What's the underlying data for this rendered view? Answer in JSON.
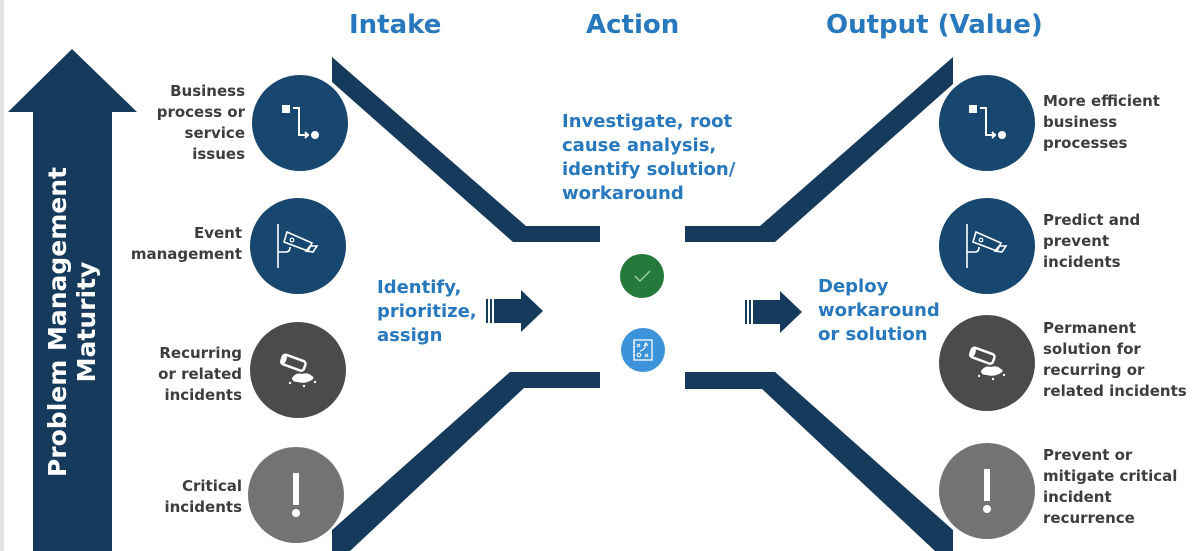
{
  "colors": {
    "navy": "#17466f",
    "dark_navy": "#153a5c",
    "accent_blue": "#2878bd",
    "text_gray": "#3d3d3d",
    "dark_gray": "#4a4b4b",
    "mid_gray": "#737373",
    "check_green": "#247a3a",
    "playbook_blue": "#3d93d9"
  },
  "maturity_arrow": {
    "line1": "Problem Management",
    "line2": "Maturity"
  },
  "columns": {
    "intake": "Intake",
    "action": "Action",
    "output": "Output (Value)"
  },
  "intake_items": [
    {
      "label": [
        "Business",
        "process or",
        "service",
        "issues"
      ],
      "icon": "process-flow-icon"
    },
    {
      "label": [
        "Event",
        "management"
      ],
      "icon": "security-camera-icon"
    },
    {
      "label": [
        "Recurring",
        "or related",
        "incidents"
      ],
      "icon": "spill-icon"
    },
    {
      "label": [
        "Critical",
        "incidents"
      ],
      "icon": "exclamation-icon"
    }
  ],
  "output_items": [
    {
      "label": [
        "More efficient",
        "business",
        "processes"
      ],
      "icon": "process-flow-icon"
    },
    {
      "label": [
        "Predict and",
        "prevent",
        "incidents"
      ],
      "icon": "security-camera-icon"
    },
    {
      "label": [
        "Permanent",
        "solution for",
        "recurring or",
        "related incidents"
      ],
      "icon": "spill-icon"
    },
    {
      "label": [
        "Prevent or",
        "mitigate critical",
        "incident",
        "recurrence"
      ],
      "icon": "exclamation-icon"
    }
  ],
  "action": {
    "investigate": [
      "Investigate, root",
      "cause analysis,",
      "identify solution/",
      "workaround"
    ],
    "identify": [
      "Identify,",
      "prioritize,",
      "assign"
    ],
    "deploy": [
      "Deploy",
      "workaround",
      "or solution"
    ],
    "center_icons": [
      "checkmark-icon",
      "playbook-icon"
    ]
  }
}
